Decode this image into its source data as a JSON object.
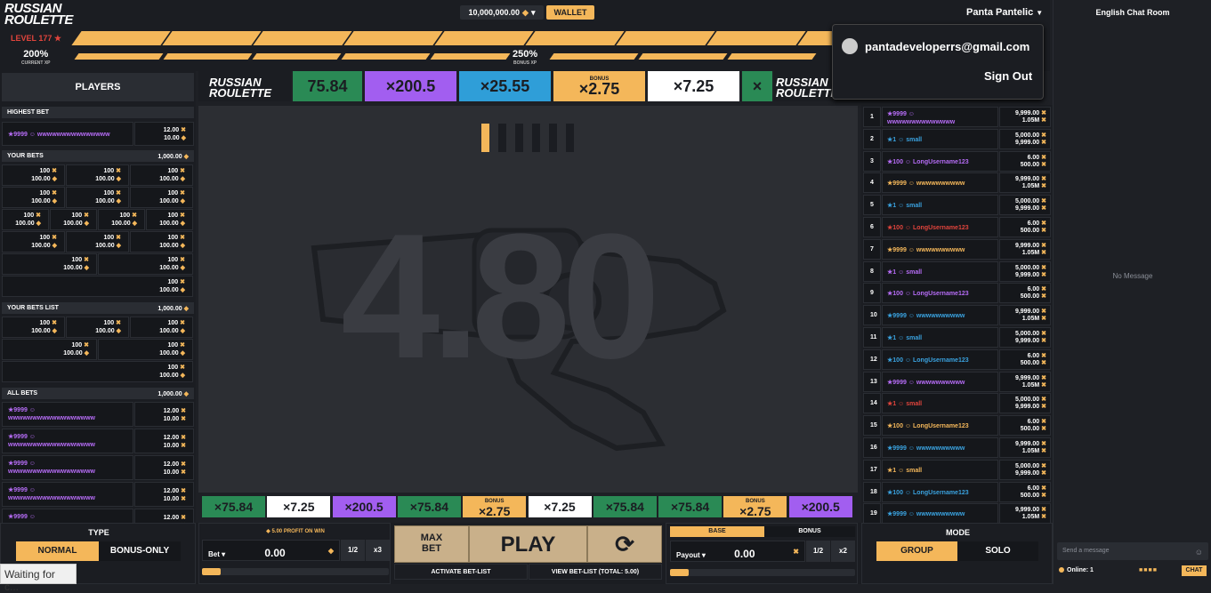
{
  "header": {
    "logo_line1": "RUSSIAN",
    "logo_line2": "ROULETTE",
    "balance": "10,000,000.00",
    "wallet_label": "WALLET",
    "username": "Panta Pantelic",
    "level": "LEVEL 177",
    "xp_pct": "200%",
    "xp_label": "CURRENT XP",
    "bonus_pct": "250%",
    "bonus_label": "BONUS XP"
  },
  "dropdown": {
    "email": "pantadeveloperrs@gmail.com",
    "sign_out": "Sign Out"
  },
  "chat": {
    "title": "English Chat Room",
    "empty": "No Message",
    "placeholder": "Send a message",
    "online": "Online: 1",
    "button": "CHAT"
  },
  "left": {
    "players_tab": "PLAYERS",
    "highest_bet": "HIGHEST BET",
    "highest": {
      "user": "9999 ☺ wwwwwwwwwwwwwww",
      "mult": "12.00",
      "amt": "10.00"
    },
    "your_bets": "YOUR BETS",
    "your_bets_total": "1,000.00",
    "bet_mult": "100",
    "bet_amt": "100.00",
    "your_bets_list": "YOUR BETS LIST",
    "your_bets_list_total": "1,000.00",
    "all_bets": "ALL BETS",
    "all_bets_total": "1,000.00",
    "all_bets_user": "9999 ☺",
    "all_bets_name": "wwwwwwwwwwwwwwwwww",
    "all_mult": "12.00",
    "all_amt": "10.00"
  },
  "top_strip": [
    {
      "label": "75.84",
      "color": "green"
    },
    {
      "label": "×200.5",
      "color": "purple"
    },
    {
      "label": "×25.55",
      "color": "blue"
    },
    {
      "label": "×2.75",
      "color": "gold",
      "bonus": "BONUS"
    },
    {
      "label": "×7.25",
      "color": "white"
    },
    {
      "label": "×",
      "color": "green"
    }
  ],
  "game": {
    "big_number": "4.80",
    "round_progress": 0.167
  },
  "bottom_strip": [
    {
      "label": "×75.84",
      "color": "green"
    },
    {
      "label": "×7.25",
      "color": "white"
    },
    {
      "label": "×200.5",
      "color": "purple"
    },
    {
      "label": "×75.84",
      "color": "green"
    },
    {
      "label": "×2.75",
      "color": "gold",
      "bonus": "BONUS"
    },
    {
      "label": "×7.25",
      "color": "white"
    },
    {
      "label": "×75.84",
      "color": "green"
    },
    {
      "label": "×75.84",
      "color": "green"
    },
    {
      "label": "×2.75",
      "color": "gold",
      "bonus": "BONUS"
    },
    {
      "label": "×200.5",
      "color": "purple"
    }
  ],
  "right_list": [
    {
      "n": "1",
      "user": "9999 ☺",
      "name": "wwwwwwwwwwwwww",
      "c": "purple",
      "a1": "9,999.00",
      "a2": "1.05M",
      "two": true
    },
    {
      "n": "2",
      "user": "1 ☺ small",
      "c": "blue",
      "a1": "5,000.00",
      "a2": "9,999.00"
    },
    {
      "n": "3",
      "user": "100 ☺ LongUsername123",
      "c": "purple",
      "a1": "6.00",
      "a2": "500.00"
    },
    {
      "n": "4",
      "user": "9999 ☺ wwwwwwwwww",
      "c": "gold",
      "a1": "9,999.00",
      "a2": "1.05M"
    },
    {
      "n": "5",
      "user": "1 ☺ small",
      "c": "blue",
      "a1": "5,000.00",
      "a2": "9,999.00"
    },
    {
      "n": "6",
      "user": "100 ☺ LongUsername123",
      "c": "red",
      "a1": "6.00",
      "a2": "500.00"
    },
    {
      "n": "7",
      "user": "9999 ☺ wwwwwwwwww",
      "c": "gold",
      "a1": "9,999.00",
      "a2": "1.05M"
    },
    {
      "n": "8",
      "user": "1 ☺ small",
      "c": "purple",
      "a1": "5,000.00",
      "a2": "9,999.00"
    },
    {
      "n": "9",
      "user": "100 ☺ LongUsername123",
      "c": "purple",
      "a1": "6.00",
      "a2": "500.00"
    },
    {
      "n": "10",
      "user": "9999 ☺ wwwwwwwwww",
      "c": "blue",
      "a1": "9,999.00",
      "a2": "1.05M"
    },
    {
      "n": "11",
      "user": "1 ☺ small",
      "c": "blue",
      "a1": "5,000.00",
      "a2": "9,999.00"
    },
    {
      "n": "12",
      "user": "100 ☺ LongUsername123",
      "c": "blue",
      "a1": "6.00",
      "a2": "500.00"
    },
    {
      "n": "13",
      "user": "9999 ☺ wwwwwwwwww",
      "c": "purple",
      "a1": "9,999.00",
      "a2": "1.05M"
    },
    {
      "n": "14",
      "user": "1 ☺ small",
      "c": "red",
      "a1": "5,000.00",
      "a2": "9,999.00"
    },
    {
      "n": "15",
      "user": "100 ☺ LongUsername123",
      "c": "gold",
      "a1": "6.00",
      "a2": "500.00"
    },
    {
      "n": "16",
      "user": "9999 ☺ wwwwwwwwww",
      "c": "blue",
      "a1": "9,999.00",
      "a2": "1.05M"
    },
    {
      "n": "17",
      "user": "1 ☺ small",
      "c": "gold",
      "a1": "5,000.00",
      "a2": "9,999.00"
    },
    {
      "n": "18",
      "user": "100 ☺ LongUsername123",
      "c": "blue",
      "a1": "6.00",
      "a2": "500.00"
    },
    {
      "n": "19",
      "user": "9999 ☺ wwwwwwwwww",
      "c": "blue",
      "a1": "9,999.00",
      "a2": "1.05M"
    }
  ],
  "controls": {
    "type_label": "TYPE",
    "normal": "NORMAL",
    "bonus_only": "BONUS-ONLY",
    "profit": "5.00 PROFIT ON WIN",
    "bet_label": "Bet",
    "bet_value": "0.00",
    "half": "1/2",
    "x3": "x3",
    "max_bet": "MAX\nBET",
    "play": "PLAY",
    "activate": "ACTIVATE BET-LIST",
    "view": "VIEW BET-LIST (TOTAL: 5.00)",
    "base": "BASE",
    "bonus": "BONUS",
    "payout_label": "Payout",
    "payout_value": "0.00",
    "x2": "x2",
    "mode_label": "MODE",
    "group": "GROUP",
    "solo": "SOLO",
    "waiting": "Waiting for c..."
  },
  "colors": {
    "accent": "#f4b75a",
    "purple": "#a25ef0",
    "green": "#2a8a55",
    "blue": "#2f9ed8",
    "red": "#e0443c"
  }
}
